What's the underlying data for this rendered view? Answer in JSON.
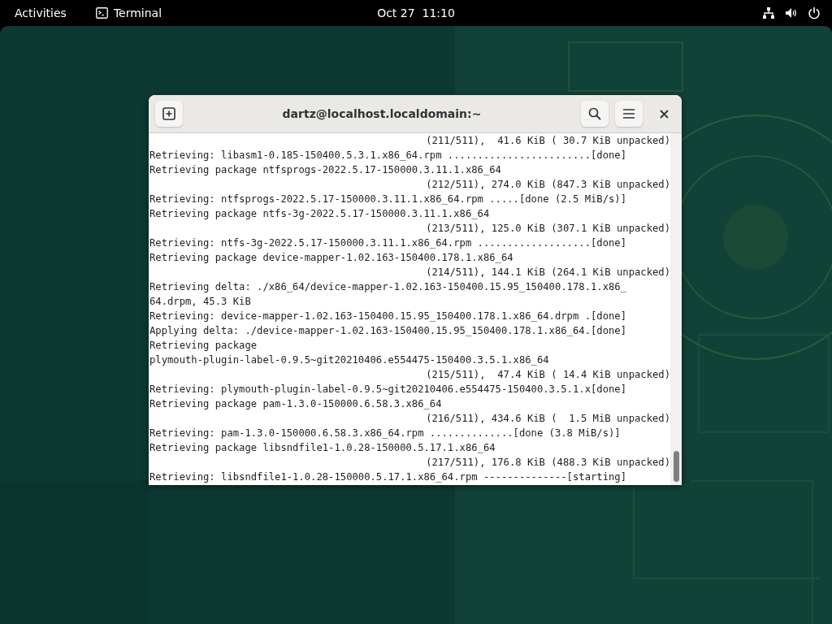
{
  "top_bar": {
    "activities": "Activities",
    "app": "Terminal",
    "clock": "Oct 27  11:10"
  },
  "window": {
    "title": "dartz@localhost.localdomain:~"
  },
  "terminal": {
    "lines": [
      {
        "kind": "progress",
        "text": "(211/511),  41.6 KiB ( 30.7 KiB unpacked)"
      },
      {
        "kind": "output",
        "text": "Retrieving: libasm1-0.185-150400.5.3.1.x86_64.rpm ........................[done]"
      },
      {
        "kind": "output",
        "text": "Retrieving package ntfsprogs-2022.5.17-150000.3.11.1.x86_64"
      },
      {
        "kind": "progress",
        "text": "(212/511), 274.0 KiB (847.3 KiB unpacked)"
      },
      {
        "kind": "output",
        "text": "Retrieving: ntfsprogs-2022.5.17-150000.3.11.1.x86_64.rpm .....[done (2.5 MiB/s)]"
      },
      {
        "kind": "output",
        "text": "Retrieving package ntfs-3g-2022.5.17-150000.3.11.1.x86_64"
      },
      {
        "kind": "progress",
        "text": "(213/511), 125.0 KiB (307.1 KiB unpacked)"
      },
      {
        "kind": "output",
        "text": "Retrieving: ntfs-3g-2022.5.17-150000.3.11.1.x86_64.rpm ...................[done]"
      },
      {
        "kind": "output",
        "text": "Retrieving package device-mapper-1.02.163-150400.178.1.x86_64"
      },
      {
        "kind": "progress",
        "text": "(214/511), 144.1 KiB (264.1 KiB unpacked)"
      },
      {
        "kind": "output",
        "text": "Retrieving delta: ./x86_64/device-mapper-1.02.163-150400.15.95_150400.178.1.x86_"
      },
      {
        "kind": "output",
        "text": "64.drpm, 45.3 KiB"
      },
      {
        "kind": "output",
        "text": "Retrieving: device-mapper-1.02.163-150400.15.95_150400.178.1.x86_64.drpm .[done]"
      },
      {
        "kind": "output",
        "text": "Applying delta: ./device-mapper-1.02.163-150400.15.95_150400.178.1.x86_64.[done]"
      },
      {
        "kind": "output",
        "text": "Retrieving package"
      },
      {
        "kind": "output",
        "text": "plymouth-plugin-label-0.9.5~git20210406.e554475-150400.3.5.1.x86_64"
      },
      {
        "kind": "progress",
        "text": "(215/511),  47.4 KiB ( 14.4 KiB unpacked)"
      },
      {
        "kind": "output",
        "text": "Retrieving: plymouth-plugin-label-0.9.5~git20210406.e554475-150400.3.5.1.x[done]"
      },
      {
        "kind": "output",
        "text": "Retrieving package pam-1.3.0-150000.6.58.3.x86_64"
      },
      {
        "kind": "progress",
        "text": "(216/511), 434.6 KiB (  1.5 MiB unpacked)"
      },
      {
        "kind": "output",
        "text": "Retrieving: pam-1.3.0-150000.6.58.3.x86_64.rpm ..............[done (3.8 MiB/s)]"
      },
      {
        "kind": "output",
        "text": "Retrieving package libsndfile1-1.0.28-150000.5.17.1.x86_64"
      },
      {
        "kind": "progress",
        "text": "(217/511), 176.8 KiB (488.3 KiB unpacked)"
      },
      {
        "kind": "output",
        "text": "Retrieving: libsndfile1-1.0.28-150000.5.17.1.x86_64.rpm --------------[starting]"
      }
    ]
  }
}
